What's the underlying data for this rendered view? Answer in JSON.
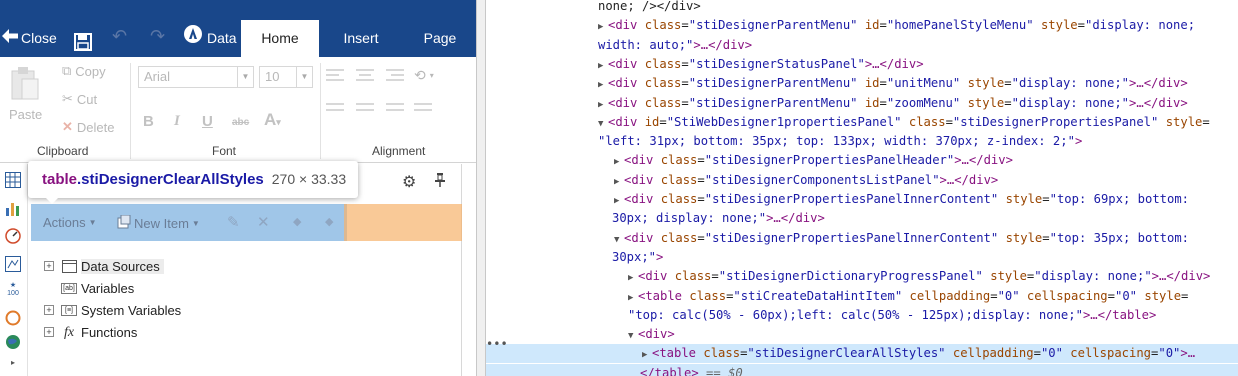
{
  "designer": {
    "topbar": {
      "close_label": "Close",
      "data_label": "Data",
      "tabs": [
        "Home",
        "Insert",
        "Page"
      ]
    },
    "ribbon": {
      "clipboard": {
        "paste": "Paste",
        "copy": "Copy",
        "cut": "Cut",
        "delete": "Delete",
        "label": "Clipboard"
      },
      "font": {
        "family": "Arial",
        "size": "10",
        "label": "Font"
      },
      "alignment": {
        "label": "Alignment"
      }
    },
    "tooltip": {
      "tag": "table",
      "class_name": ".stiDesignerClearAllStyles",
      "size": "270 × 33.33"
    },
    "dictionary_toolbar": {
      "actions": "Actions",
      "new_item": "New Item"
    },
    "tree": [
      {
        "label": "Data Sources",
        "expandable": true,
        "icon": "data-sources-icon"
      },
      {
        "label": "Variables",
        "expandable": false,
        "icon": "variables-icon"
      },
      {
        "label": "System Variables",
        "expandable": true,
        "icon": "system-variables-icon"
      },
      {
        "label": "Functions",
        "expandable": true,
        "icon": "functions-icon"
      }
    ],
    "sidebar_badge": "100"
  },
  "devtools": {
    "lines": [
      {
        "indent": 0,
        "text": "none; /></div>"
      },
      {
        "indent": 0,
        "tag": "div",
        "attrs": [
          [
            "class",
            "stiDesignerParentMenu"
          ],
          [
            "id",
            "homePanelStyleMenu"
          ],
          [
            "style",
            "display: none;"
          ]
        ]
      },
      {
        "indent": 0,
        "text": "width: auto;\">…</div>"
      },
      {
        "indent": 0,
        "tag": "div",
        "attrs": [
          [
            "class",
            "stiDesignerStatusPanel"
          ]
        ],
        "closed": true
      },
      {
        "indent": 0,
        "tag": "div",
        "attrs": [
          [
            "class",
            "stiDesignerParentMenu"
          ],
          [
            "id",
            "unitMenu"
          ],
          [
            "style",
            "display: none;"
          ]
        ],
        "closed": true
      },
      {
        "indent": 0,
        "tag": "div",
        "attrs": [
          [
            "class",
            "stiDesignerParentMenu"
          ],
          [
            "id",
            "zoomMenu"
          ],
          [
            "style",
            "display: none;"
          ]
        ],
        "closed": true
      },
      {
        "indent": 0,
        "tag": "div",
        "attrs": [
          [
            "id",
            "StiWebDesigner1propertiesPanel"
          ],
          [
            "class",
            "stiDesignerPropertiesPanel"
          ],
          [
            "style",
            ""
          ]
        ],
        "open": true
      },
      {
        "indent": 0,
        "text": "\"left: 31px; bottom: 35px; top: 133px; width: 370px; z-index: 2;\">"
      },
      {
        "indent": 1,
        "tag": "div",
        "attrs": [
          [
            "class",
            "stiDesignerPropertiesPanelHeader"
          ]
        ],
        "closed": true
      },
      {
        "indent": 1,
        "tag": "div",
        "attrs": [
          [
            "class",
            "stiDesignerComponentsListPanel"
          ]
        ],
        "closed": true
      },
      {
        "indent": 1,
        "tag": "div",
        "attrs": [
          [
            "class",
            "stiDesignerPropertiesPanelInnerContent"
          ],
          [
            "style",
            "top: 69px; bottom:"
          ]
        ]
      },
      {
        "indent": 1,
        "text": "30px; display: none;\">…</div>"
      },
      {
        "indent": 1,
        "tag": "div",
        "attrs": [
          [
            "class",
            "stiDesignerPropertiesPanelInnerContent"
          ],
          [
            "style",
            "top: 35px; bottom:"
          ]
        ],
        "open": true
      },
      {
        "indent": 1,
        "text": "30px;\">"
      },
      {
        "indent": 2,
        "tag": "div",
        "attrs": [
          [
            "class",
            "stiDesignerDictionaryProgressPanel"
          ],
          [
            "style",
            "display: none;"
          ]
        ],
        "closed": true
      },
      {
        "indent": 2,
        "tag": "table",
        "attrs": [
          [
            "class",
            "stiCreateDataHintItem"
          ],
          [
            "cellpadding",
            "0"
          ],
          [
            "cellspacing",
            "0"
          ],
          [
            "style",
            ""
          ]
        ]
      },
      {
        "indent": 2,
        "text": "\"top: calc(50% - 60px);left: calc(50% - 125px);display: none;\">…</table>"
      },
      {
        "indent": 2,
        "text": "<div>",
        "open": true
      },
      {
        "indent": 3,
        "tag": "table",
        "attrs": [
          [
            "class",
            "stiDesignerClearAllStyles"
          ],
          [
            "cellpadding",
            "0"
          ],
          [
            "cellspacing",
            "0"
          ]
        ],
        "selected": true
      },
      {
        "indent": 3,
        "text": "</table> == $0",
        "selected": true
      }
    ]
  }
}
